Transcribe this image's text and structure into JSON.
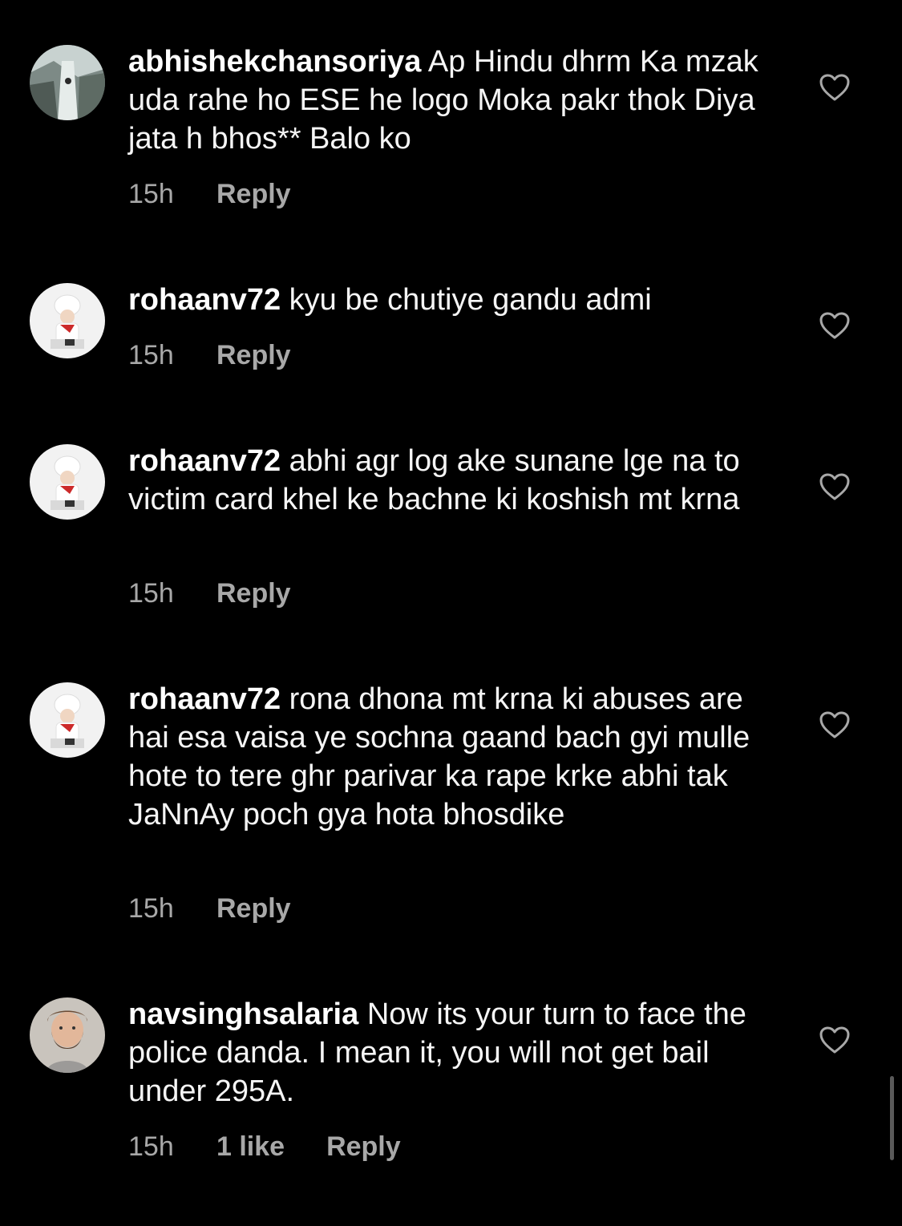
{
  "colors": {
    "background": "#000000",
    "text": "#f5f5f5",
    "meta": "#a8a8a8"
  },
  "comments": [
    {
      "username": "abhishekchansoriya",
      "text": "Ap Hindu dhrm Ka mzak uda rahe ho ESE he logo Moka pakr thok Diya jata h bhos** Balo ko",
      "time": "15h",
      "likes": "",
      "reply": "Reply",
      "avatar_icon": "waterfall-avatar",
      "like_icon": "heart-outline-icon"
    },
    {
      "username": "rohaanv72",
      "text": "kyu be chutiye gandu admi",
      "time": "15h",
      "likes": "",
      "reply": "Reply",
      "avatar_icon": "child-in-white-hat-avatar",
      "like_icon": "heart-outline-icon"
    },
    {
      "username": "rohaanv72",
      "text": "abhi agr log ake sunane lge na to victim card khel ke bachne ki koshish mt krna",
      "time": "15h",
      "likes": "",
      "reply": "Reply",
      "avatar_icon": "child-in-white-hat-avatar",
      "like_icon": "heart-outline-icon"
    },
    {
      "username": "rohaanv72",
      "text": "rona dhona mt krna ki abuses are hai esa vaisa ye sochna gaand bach gyi mulle hote to tere ghr parivar ka rape krke abhi tak JaNnAy poch gya hota bhosdike",
      "time": "15h",
      "likes": "",
      "reply": "Reply",
      "avatar_icon": "child-in-white-hat-avatar",
      "like_icon": "heart-outline-icon"
    },
    {
      "username": "navsinghsalaria",
      "text": "Now its your turn to face the police danda. I mean it, you will not get bail under 295A.",
      "time": "15h",
      "likes": "1 like",
      "reply": "Reply",
      "avatar_icon": "bearded-man-avatar",
      "like_icon": "heart-outline-icon"
    }
  ]
}
